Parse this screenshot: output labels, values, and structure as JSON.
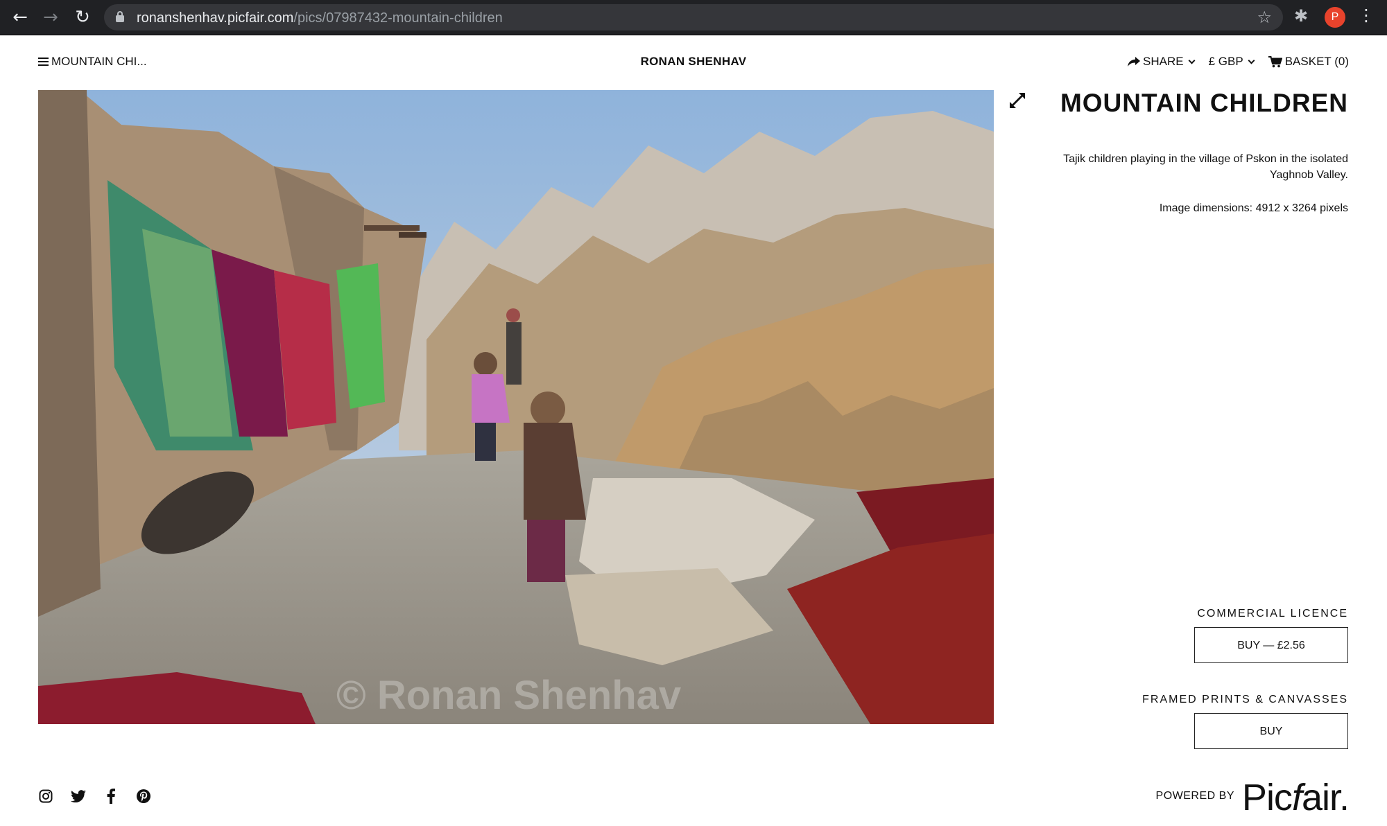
{
  "browser": {
    "url_host": "ronanshenhav.picfair.com",
    "url_path": "/pics/07987432-mountain-children",
    "profile_initial": "P",
    "icons": [
      "back-icon",
      "forward-icon",
      "reload-icon",
      "lock-icon",
      "star-icon",
      "extensions-icon",
      "more-icon"
    ]
  },
  "header": {
    "menu_label": "MOUNTAIN CHI...",
    "site_name": "RONAN SHENHAV",
    "share_label": "SHARE",
    "currency_label": "£ GBP",
    "basket_label": "BASKET (0)"
  },
  "photo": {
    "watermark": "© Ronan Shenhav"
  },
  "details": {
    "title": "MOUNTAIN CHILDREN",
    "description": "Tajik children playing in the village of Pskon in the isolated Yaghnob Valley.",
    "dimensions": "Image dimensions: 4912 x 3264 pixels"
  },
  "purchase": {
    "licence_label": "COMMERCIAL LICENCE",
    "licence_button": "BUY — £2.56",
    "prints_label": "FRAMED PRINTS & CANVASSES",
    "prints_button": "BUY"
  },
  "footer": {
    "social_icons": [
      "instagram-icon",
      "twitter-icon",
      "facebook-icon",
      "pinterest-icon"
    ],
    "powered_by": "POWERED BY",
    "brand_left": "Pic",
    "brand_f": "f",
    "brand_right": "air."
  },
  "colors": {
    "chrome_bg": "#202124",
    "omnibox_bg": "#35363a",
    "avatar": "#e8432c",
    "text": "#111111"
  }
}
